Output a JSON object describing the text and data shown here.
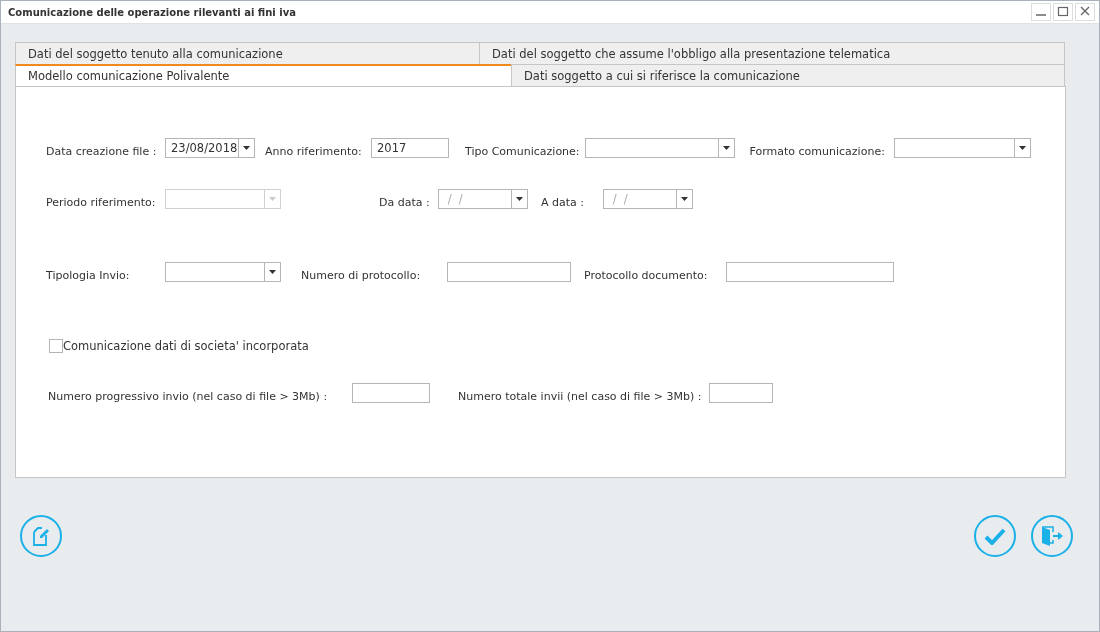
{
  "window": {
    "title": "Comunicazione delle operazione rilevanti ai fini iva"
  },
  "tab_rows": [
    [
      {
        "label": "Dati del soggetto tenuto alla comunicazione",
        "selected": false
      },
      {
        "label": "Dati del soggetto che assume l'obbligo alla presentazione telematica",
        "selected": false
      }
    ],
    [
      {
        "label": "Modello comunicazione Polivalente",
        "selected": true
      },
      {
        "label": "Dati soggetto a cui si riferisce la comunicazione",
        "selected": false
      }
    ]
  ],
  "form_rows": [
    [
      {
        "label": "Data creazione file :",
        "kind": "combo",
        "value": "23/08/2018",
        "disabled": false
      },
      {
        "label": "Anno riferimento:",
        "kind": "text",
        "value": "2017",
        "disabled": false
      },
      {
        "label": "Tipo Comunicazione:",
        "kind": "combo",
        "disabled": false
      },
      {
        "label": "Formato comunicazione:",
        "kind": "combo",
        "disabled": false
      }
    ],
    [
      {
        "label": "Periodo riferimento:",
        "kind": "combo",
        "disabled": true
      },
      {
        "label": "Da data :",
        "kind": "combo",
        "placeholder": " /  /",
        "disabled": false
      },
      {
        "label": "A data :",
        "kind": "combo",
        "placeholder": " /  /",
        "disabled": false
      }
    ],
    [
      {
        "label": "Tipologia Invio:",
        "kind": "combo",
        "disabled": false
      },
      {
        "label": "Numero di protocollo:",
        "kind": "text",
        "disabled": false
      },
      {
        "label": "Protocollo documento:",
        "kind": "text",
        "disabled": false
      }
    ]
  ],
  "checkbox": {
    "label": "Comunicazione dati di societa' incorporata",
    "checked": false
  },
  "bottom_row": [
    {
      "label": "Numero progressivo invio (nel caso di file > 3Mb) :",
      "kind": "text",
      "disabled": false
    },
    {
      "label": "Numero totale invii (nel caso di file > 3Mb) :",
      "kind": "text",
      "disabled": false
    }
  ]
}
